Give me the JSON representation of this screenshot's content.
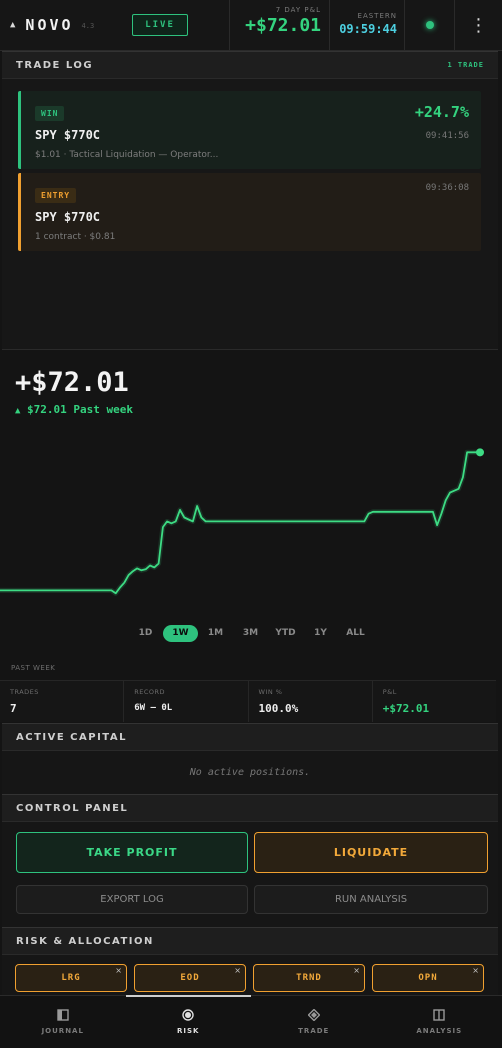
{
  "header": {
    "brand": "NOVO",
    "version": "4.3",
    "live_label": "LIVE",
    "pnl_label": "7 DAY P&L",
    "pnl_value": "+$72.01",
    "clock_label": "EASTERN",
    "clock_value": "09:59:44",
    "menu_glyph": "⋮"
  },
  "trade_log": {
    "title": "TRADE LOG",
    "count": "1 TRADE",
    "cards": [
      {
        "badge": "WIN",
        "symbol": "SPY $770C",
        "detail": "$1.01 · Tactical Liquidation — Operator...",
        "pct": "+24.7%",
        "time": "09:41:56"
      },
      {
        "badge": "ENTRY",
        "symbol": "SPY $770C",
        "detail": "1 contract · $0.81",
        "time": "09:36:08"
      }
    ]
  },
  "performance": {
    "value": "+$72.01",
    "change_arrow": "▲",
    "change_text": "$72.01 Past week",
    "ranges": [
      "1D",
      "1W",
      "1M",
      "3M",
      "YTD",
      "1Y",
      "ALL"
    ],
    "active_range": "1W"
  },
  "chart_data": {
    "type": "line",
    "title": "",
    "xlabel": "",
    "ylabel": "",
    "series": [
      {
        "values": [
          0,
          0,
          0,
          0,
          0,
          0,
          0,
          0,
          0,
          0,
          0,
          0,
          0,
          0,
          0,
          0,
          0,
          0,
          0,
          0,
          0,
          0,
          0,
          0,
          0,
          0,
          0,
          -1.5,
          1.5,
          4,
          8,
          10,
          11.5,
          10.5,
          11,
          13,
          12,
          14,
          33,
          36,
          35,
          36,
          42,
          38,
          37,
          36,
          44,
          38,
          36,
          36,
          36,
          36,
          36,
          36,
          36,
          36,
          36,
          36,
          36,
          36,
          36,
          36,
          36,
          36,
          36,
          36,
          36,
          36,
          36,
          36,
          36,
          36,
          36,
          36,
          36,
          36,
          36,
          36,
          36,
          36,
          36,
          36,
          36,
          36,
          36,
          36,
          40,
          41,
          41,
          41,
          41,
          41,
          41,
          41,
          41,
          41,
          41,
          41,
          41,
          41,
          41,
          41,
          34,
          40,
          47,
          51,
          52,
          53,
          59,
          72,
          72,
          72,
          72.01
        ]
      }
    ],
    "ylim": [
      -5,
      80
    ],
    "grid": false,
    "line_color": "#3ddc84",
    "end_marker": true
  },
  "stats": {
    "period": "PAST WEEK",
    "items": [
      {
        "label": "TRADES",
        "value": "7"
      },
      {
        "label": "RECORD",
        "value": "6W — 0L"
      },
      {
        "label": "WIN %",
        "value": "100.0%"
      },
      {
        "label": "P&L",
        "value": "+$72.01"
      }
    ]
  },
  "active_capital": {
    "title": "ACTIVE CAPITAL",
    "empty": "No active positions."
  },
  "control_panel": {
    "title": "CONTROL PANEL",
    "take_profit": "TAKE PROFIT",
    "liquidate": "LIQUIDATE",
    "export_log": "EXPORT LOG",
    "run_analysis": "RUN ANALYSIS"
  },
  "risk": {
    "title": "RISK & ALLOCATION",
    "chips": [
      "LRG",
      "EOD",
      "TRND",
      "OPN"
    ],
    "close_glyph": "×"
  },
  "nav": {
    "items": [
      {
        "label": "JOURNAL",
        "icon": "journal-icon"
      },
      {
        "label": "RISK",
        "icon": "risk-icon"
      },
      {
        "label": "TRADE",
        "icon": "trade-icon"
      },
      {
        "label": "ANALYSIS",
        "icon": "analysis-icon"
      }
    ],
    "active": "RISK"
  },
  "colors": {
    "accent_green": "#2ec27e",
    "accent_orange": "#f0a030",
    "clock_cyan": "#4dd0e1"
  }
}
